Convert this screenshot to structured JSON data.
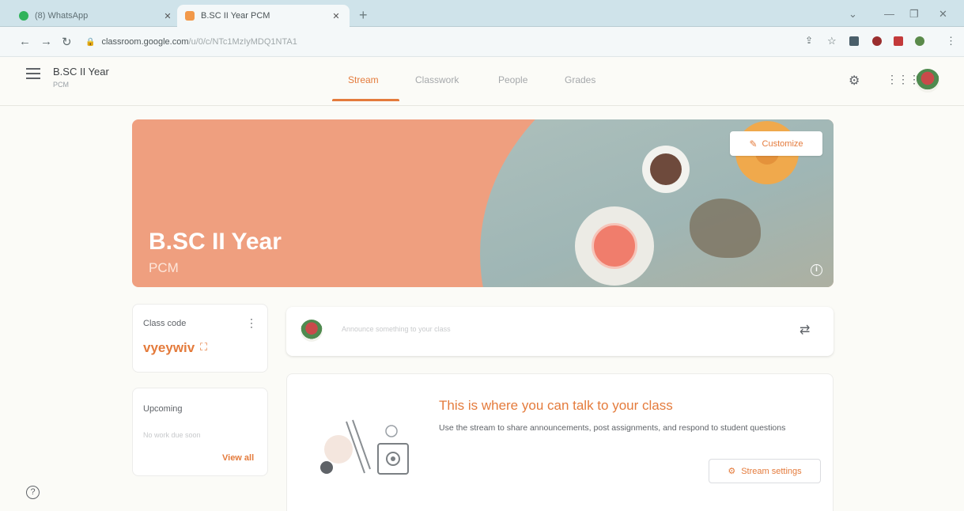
{
  "browser": {
    "tabs": [
      {
        "title": "(8) WhatsApp",
        "favicon": "whatsapp-icon"
      },
      {
        "title": "B.SC II Year PCM",
        "favicon": "classroom-icon"
      }
    ],
    "url_host": "classroom.google.com",
    "url_path": "/u/0/c/NTc1MzIyMDQ1NTA1"
  },
  "header": {
    "class_name": "B.SC II Year",
    "class_section": "PCM",
    "nav_tabs": [
      "Stream",
      "Classwork",
      "People",
      "Grades"
    ],
    "active_tab": "Stream"
  },
  "banner": {
    "title": "B.SC II Year",
    "subtitle": "PCM",
    "customize_label": "Customize"
  },
  "class_code": {
    "label": "Class code",
    "code": "vyeywiv"
  },
  "upcoming": {
    "label": "Upcoming",
    "empty_text": "No work due soon",
    "view_all": "View all"
  },
  "announce": {
    "placeholder": "Announce something to your class"
  },
  "talk": {
    "heading": "This is where you can talk to your class",
    "description": "Use the stream to share announcements, post assignments, and respond to student questions",
    "button_label": "Stream settings"
  },
  "colors": {
    "accent": "#e47b3c",
    "banner": "#ef9f7f"
  }
}
